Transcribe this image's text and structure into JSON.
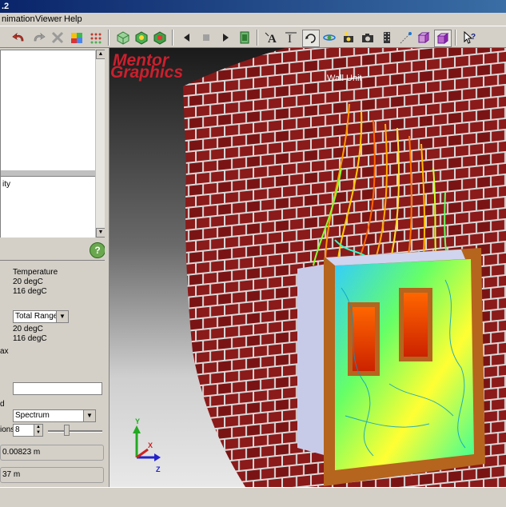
{
  "window": {
    "title_fragment": ".2"
  },
  "menu": {
    "items": [
      "nimation",
      "Viewer",
      "Help"
    ]
  },
  "toolbar": {
    "icons": [
      "undo-icon",
      "redo-icon",
      "delete-icon",
      "color-palette-icon",
      "grid-dots-icon",
      "cube-views-icon",
      "cube-views-icon",
      "cube-views-icon",
      "play-back-icon",
      "stop-icon",
      "play-forward-icon",
      "record-icon",
      "text-icon",
      "text-icon",
      "rotate-icon",
      "spin-icon",
      "camera-lights-icon",
      "camera-icon",
      "film-icon",
      "sparkle-icon",
      "box-icon",
      "box-3d-icon",
      "help-cursor-icon"
    ]
  },
  "tree": {
    "lower_item_fragment": "ity"
  },
  "properties": {
    "variable_value": "Temperature",
    "min_value": "20 degC",
    "max_value": "116 degC",
    "range_select": "Total Range",
    "range_min": "20 degC",
    "range_max": "116 degC",
    "max_label_fragment": "ax",
    "name_label_fragment": "d",
    "name_value": "",
    "colormap_select": "Spectrum",
    "divisions_label_fragment": "ions",
    "divisions_value": "8",
    "readout_1": "0.00823 m",
    "readout_2": "37 m"
  },
  "viewport": {
    "logo_line1": "Mentor",
    "logo_line2": "Graphics",
    "object_label": "Wall Unit",
    "axis_labels": {
      "y": "Y",
      "x": "X",
      "z": "Z"
    },
    "colors": {
      "brick": "#8b1a1a",
      "mortar": "#d9d9d9",
      "frame": "#b5651d",
      "panel": "#c8cbe8"
    }
  }
}
